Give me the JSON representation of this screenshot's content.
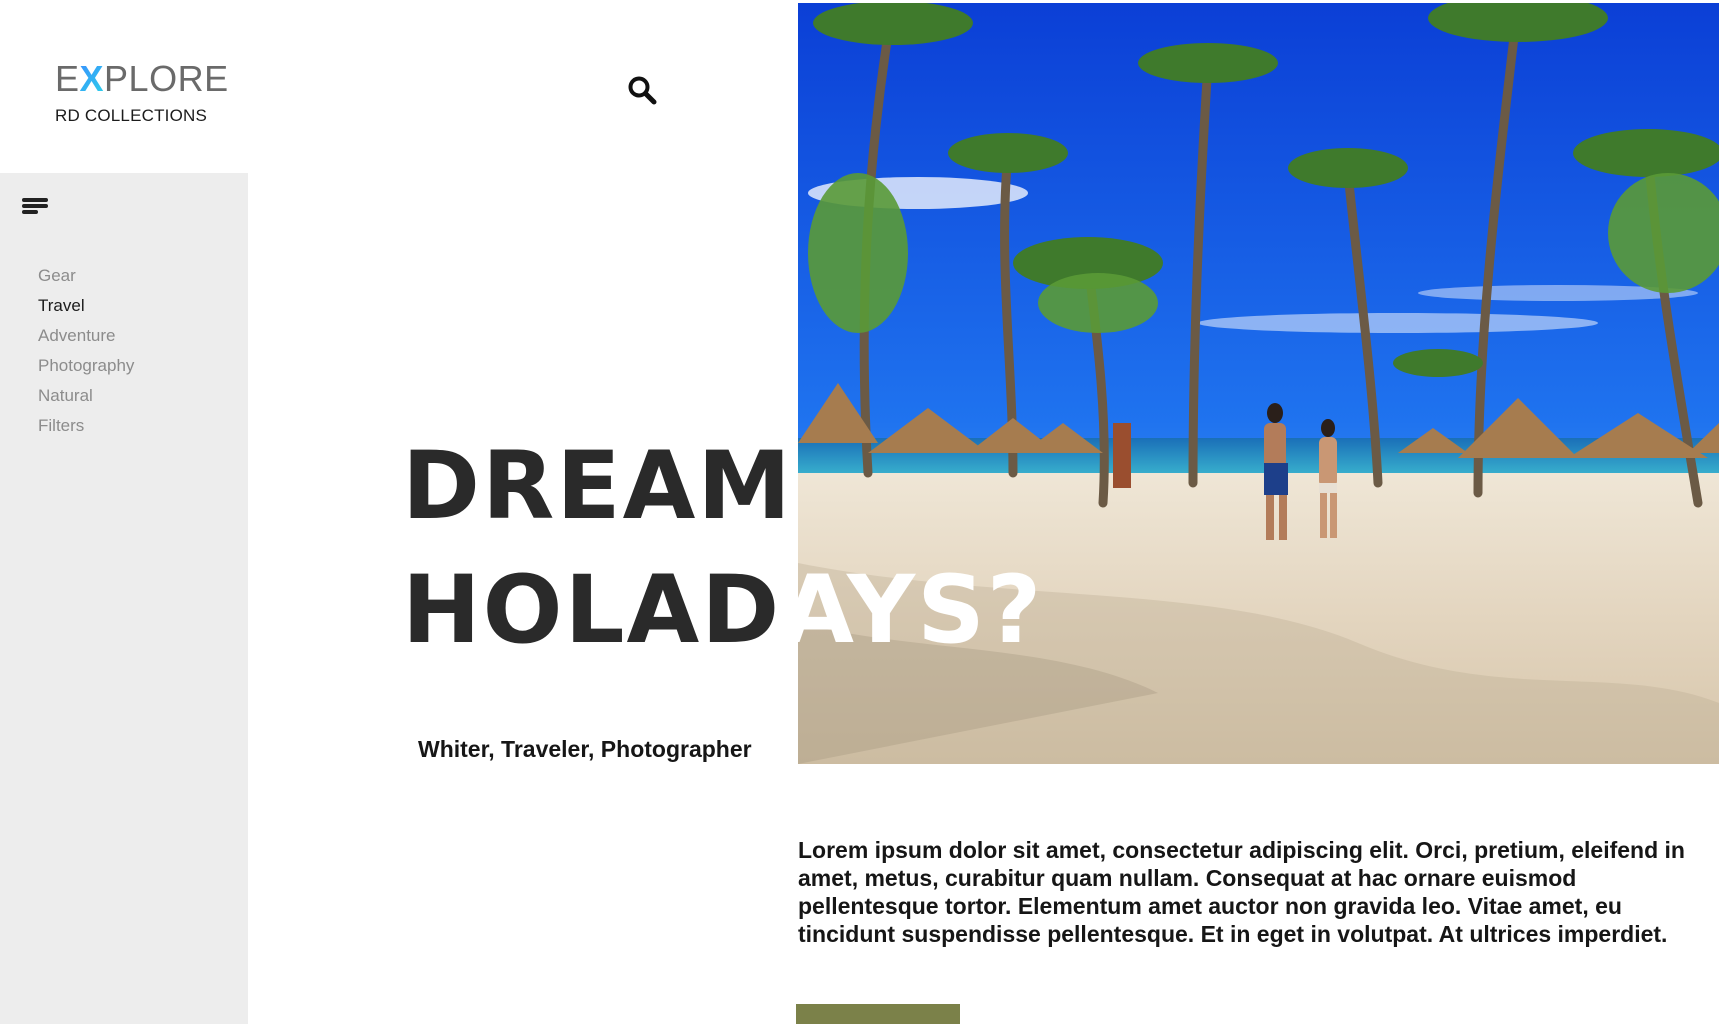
{
  "brand": {
    "word_before": "E",
    "word_x": "X",
    "word_after": "PLORE",
    "subtitle": "RD COLLECTIONS",
    "accent_gradient": [
      "#3a8dff",
      "#2bd4e8"
    ]
  },
  "header": {
    "search_icon": "search-icon"
  },
  "sidebar": {
    "menu_icon": "hamburger-menu-icon",
    "items": [
      {
        "label": "Gear",
        "active": false
      },
      {
        "label": "Travel",
        "active": true
      },
      {
        "label": "Adventure",
        "active": false
      },
      {
        "label": "Photography",
        "active": false
      },
      {
        "label": "Natural",
        "active": false
      },
      {
        "label": "Filters",
        "active": false
      }
    ]
  },
  "hero": {
    "line1": "DREAM",
    "line2_dark": "HOLAD",
    "line2_light": "AYS?",
    "tagline": "Whiter, Traveler, Photographer"
  },
  "content": {
    "body": "Lorem ipsum dolor sit amet, consectetur adipiscing elit. Orci, pretium, eleifend in amet, metus, curabitur quam nullam. Consequat at hac ornare euismod pellentesque tortor. Elementum amet auctor non gravida leo. Vitae amet, eu tincidunt suspendisse pellentesque. Et in eget in volutpat. At ultrices imperdiet."
  },
  "colors": {
    "sidebar_bg": "#ededed",
    "cta_bg": "#7b8149",
    "nav_inactive": "#8c8c8c",
    "nav_active": "#1c1c1c"
  }
}
